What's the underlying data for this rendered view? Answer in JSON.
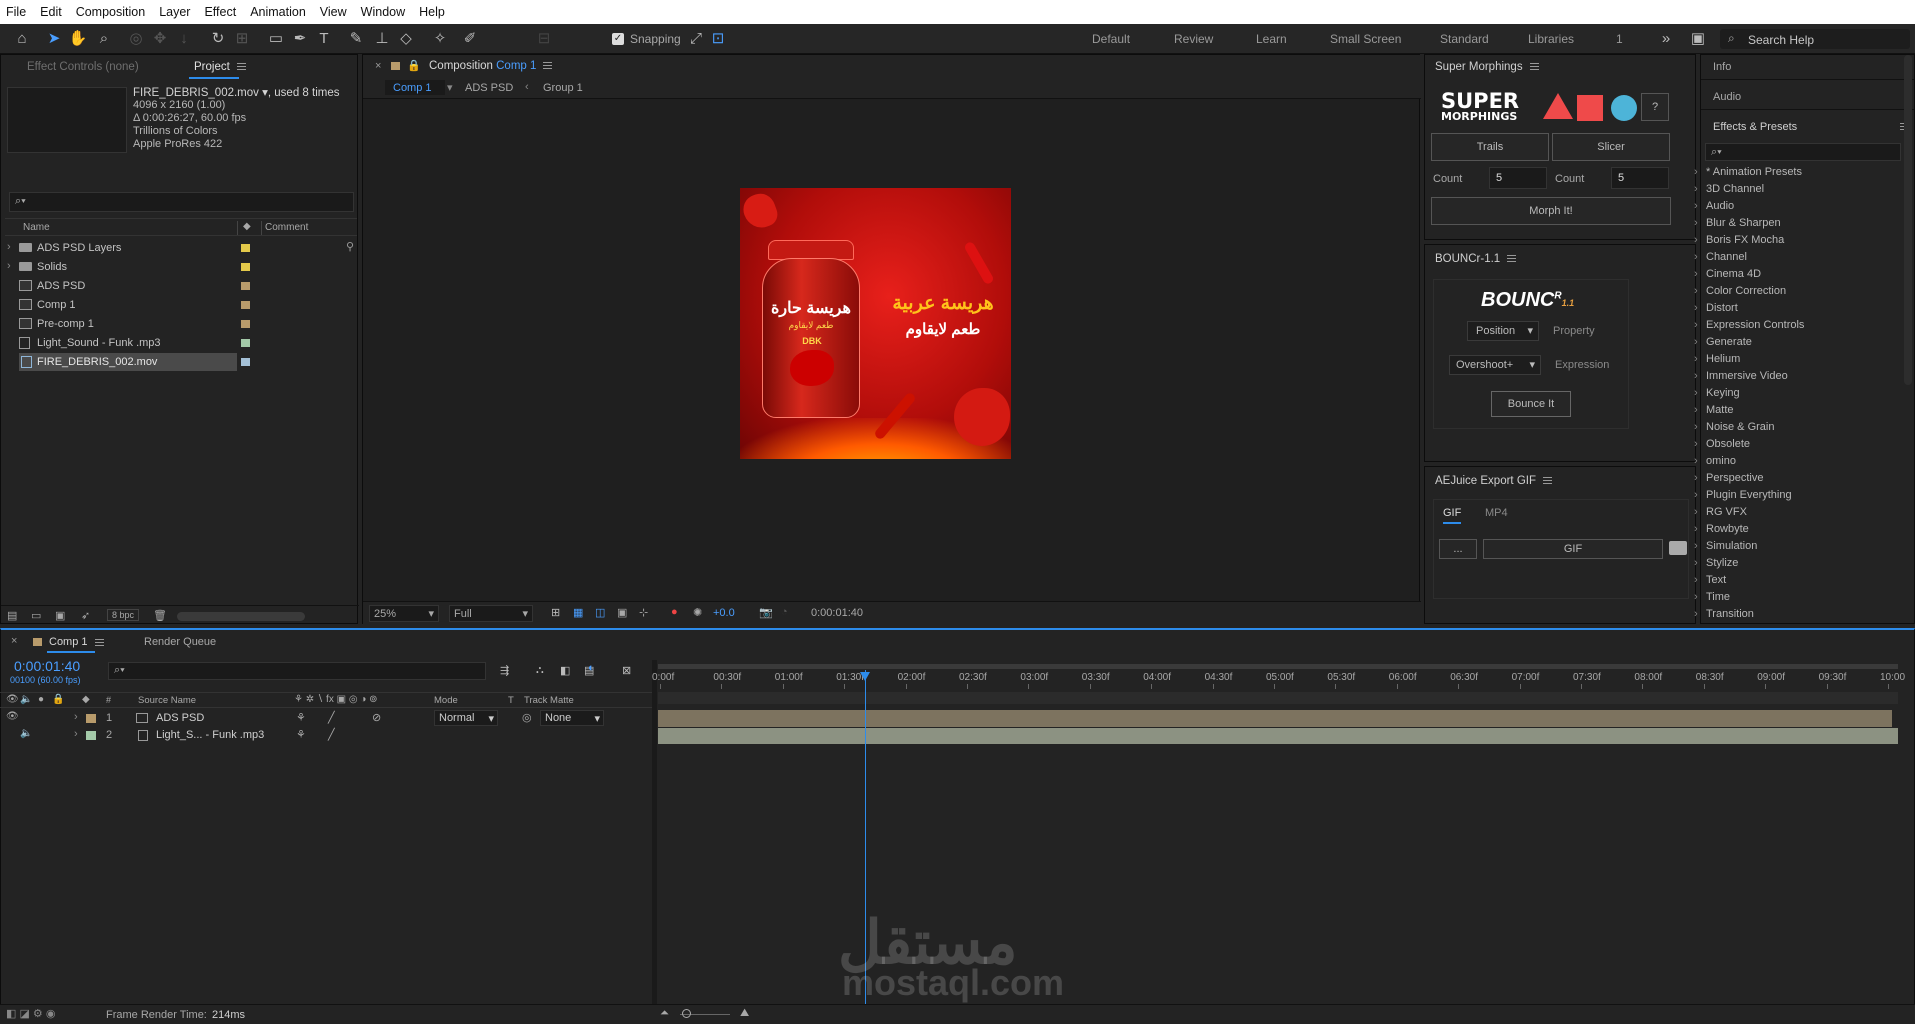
{
  "menu": [
    "File",
    "Edit",
    "Composition",
    "Layer",
    "Effect",
    "Animation",
    "View",
    "Window",
    "Help"
  ],
  "toolbar": {
    "snapping": "Snapping",
    "workspaces": [
      "Default",
      "Review",
      "Learn",
      "Small Screen",
      "Standard",
      "Libraries",
      "1"
    ],
    "search_placeholder": "Search Help"
  },
  "project": {
    "tab_effect_controls": "Effect Controls (none)",
    "tab_project": "Project",
    "info_name": "FIRE_DEBRIS_002.mov",
    "info_used": ", used 8 times",
    "info_lines": [
      "4096 x 2160 (1.00)",
      "Δ 0:00:26:27, 60.00 fps",
      "Trillions of Colors",
      "Apple ProRes 422"
    ],
    "col_name": "Name",
    "col_comment": "Comment",
    "items": [
      {
        "label": "ADS PSD Layers",
        "color": "#e3c94a"
      },
      {
        "label": "Solids",
        "color": "#e3c94a"
      },
      {
        "label": "ADS PSD",
        "color": "#b89b6b"
      },
      {
        "label": "Comp 1",
        "color": "#b89b6b"
      },
      {
        "label": "Pre-comp 1",
        "color": "#b89b6b"
      },
      {
        "label": "Light_Sound - Funk .mp3",
        "color": "#a3c9a8"
      },
      {
        "label": "FIRE_DEBRIS_002.mov",
        "color": "#a4c0d6"
      }
    ],
    "bpc": "8 bpc"
  },
  "composition": {
    "tab_prefix": "Composition",
    "tab_name": "Comp 1",
    "crumbs": [
      "Comp 1",
      "ADS PSD",
      "Group 1"
    ],
    "zoom": "25%",
    "resolution": "Full",
    "exposure": "+0.0",
    "timecode": "0:00:01:40"
  },
  "artwork": {
    "title_left": "هريسة حارة",
    "subtitle_left": "طعم لايقاوم",
    "brand": "DBK",
    "title_right": "هريسة عربية",
    "subtitle_right": "طعم لايقاوم"
  },
  "super_morphings": {
    "title": "Super Morphings",
    "logo_line1": "SUPER",
    "logo_line2": "MORPHINGS",
    "help": "?",
    "trails": "Trails",
    "slicer": "Slicer",
    "count_label": "Count",
    "count1": "5",
    "count2": "5",
    "morph": "Morph It!"
  },
  "bouncr": {
    "title": "BOUNCr-1.1",
    "logo": "BOUNC",
    "logo_sup": "R",
    "logo_ver": "1.1",
    "position": "Position",
    "property": "Property",
    "overshoot": "Overshoot+",
    "expression": "Expression",
    "bounce": "Bounce It"
  },
  "aejuice": {
    "title": "AEJuice Export GIF",
    "tab_gif": "GIF",
    "tab_mp4": "MP4",
    "dots": "...",
    "gif_btn": "GIF"
  },
  "side": {
    "info": "Info",
    "audio": "Audio",
    "effects_presets": "Effects & Presets",
    "items": [
      "* Animation Presets",
      "3D Channel",
      "Audio",
      "Blur & Sharpen",
      "Boris FX Mocha",
      "Channel",
      "Cinema 4D",
      "Color Correction",
      "Distort",
      "Expression Controls",
      "Generate",
      "Helium",
      "Immersive Video",
      "Keying",
      "Matte",
      "Noise & Grain",
      "Obsolete",
      "omino",
      "Perspective",
      "Plugin Everything",
      "RG VFX",
      "Rowbyte",
      "Simulation",
      "Stylize",
      "Text",
      "Time",
      "Transition"
    ]
  },
  "timeline": {
    "tab_comp": "Comp 1",
    "tab_render": "Render Queue",
    "timecode": "0:00:01:40",
    "frames": "00100 (60.00 fps)",
    "col_num": "#",
    "col_source": "Source Name",
    "col_mode": "Mode",
    "col_t": "T",
    "col_matte": "Track Matte",
    "layers": [
      {
        "num": "1",
        "name": "ADS PSD",
        "color": "#b89b6b",
        "mode": "Normal",
        "matte": "None"
      },
      {
        "num": "2",
        "name": "Light_S... - Funk .mp3",
        "color": "#a3c9a8",
        "mode": "",
        "matte": ""
      }
    ],
    "ticks": [
      "0:00f",
      "00:30f",
      "01:00f",
      "01:30f",
      "02:00f",
      "02:30f",
      "03:00f",
      "03:30f",
      "04:00f",
      "04:30f",
      "05:00f",
      "05:30f",
      "06:00f",
      "06:30f",
      "07:00f",
      "07:30f",
      "08:00f",
      "08:30f",
      "09:00f",
      "09:30f",
      "10:00"
    ],
    "playhead_seconds": 1.667,
    "duration_seconds": 10,
    "frame_render_label": "Frame Render Time:",
    "frame_render_value": "214ms"
  },
  "watermark": {
    "arabic": "مستقل",
    "latin": "mostaql.com"
  }
}
